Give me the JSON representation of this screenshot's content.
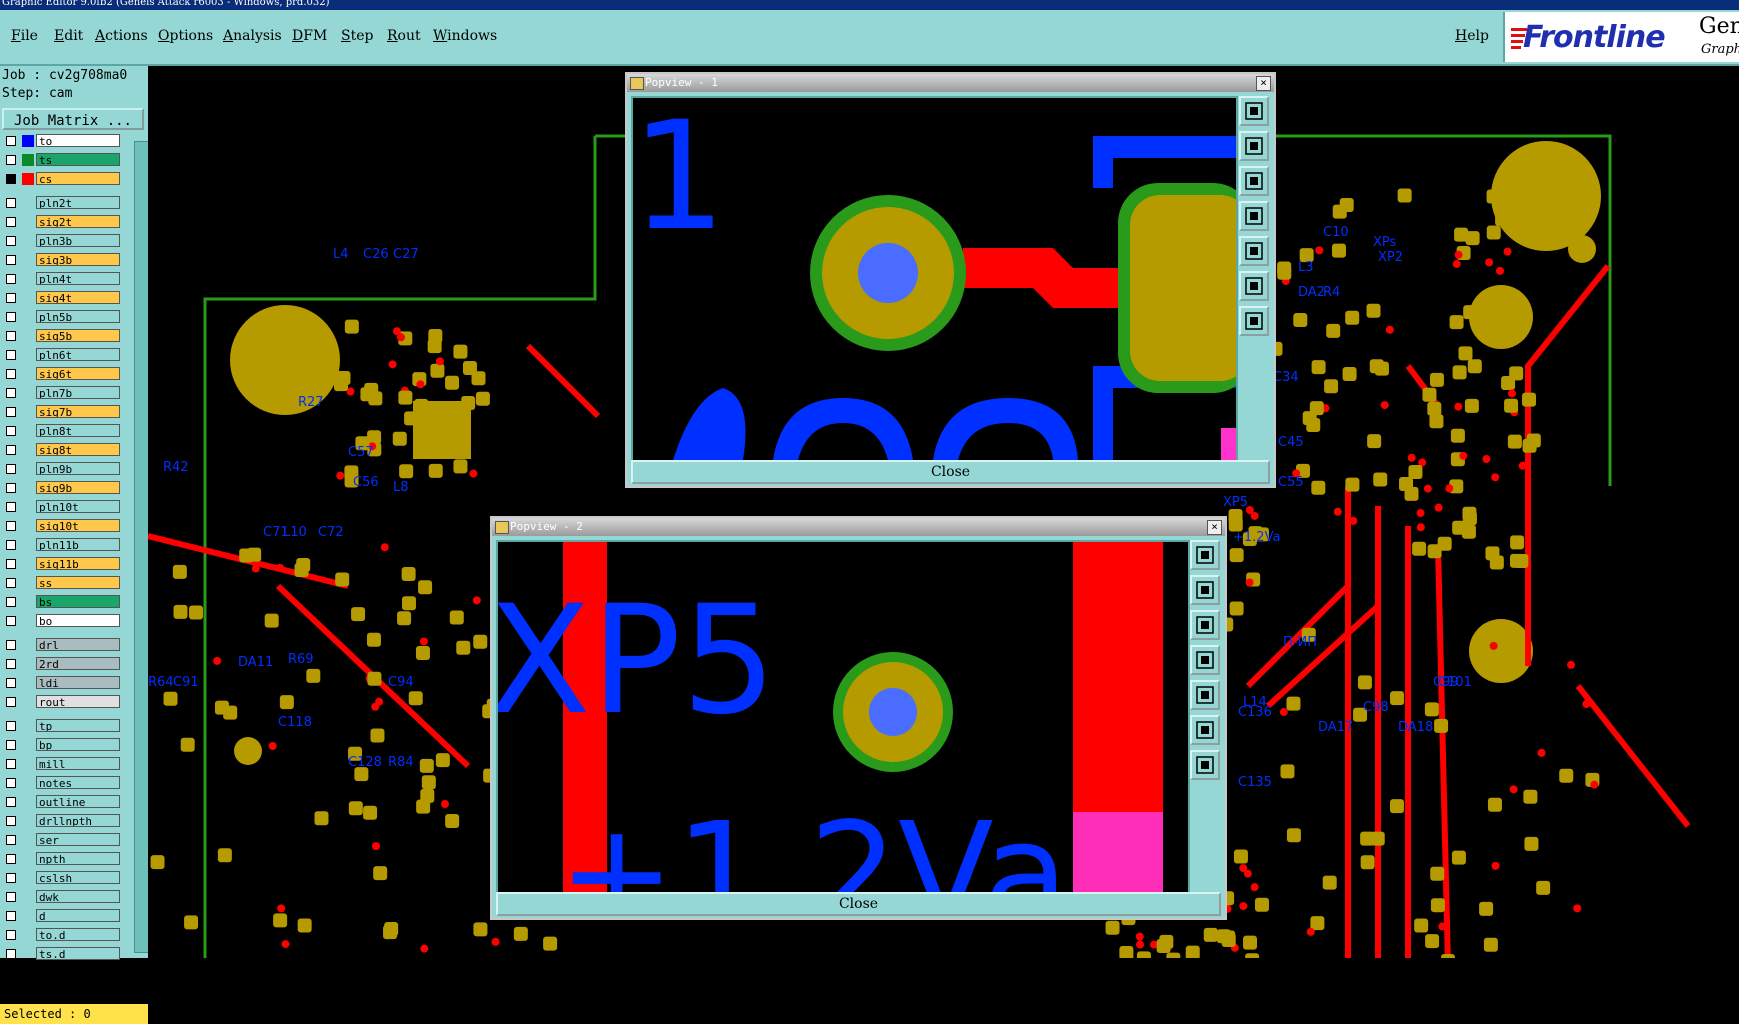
{
  "window": {
    "title": "Graphic Editor 9.0fb2 (Geneis Attack r6003 - Windows, prd.032)"
  },
  "menu": {
    "file": "File",
    "edit": "Edit",
    "actions": "Actions",
    "options": "Options",
    "analysis": "Analysis",
    "dfm": "DFM",
    "step": "Step",
    "rout": "Rout",
    "windows": "Windows",
    "help": "Help"
  },
  "logo": {
    "brand": "Frontline",
    "product": "Genesi",
    "subtitle": "Graphi"
  },
  "job": {
    "job_line": "Job : cv2g708ma0",
    "step_line": "Step: cam",
    "matrix_button": "Job Matrix ..."
  },
  "layers": [
    {
      "name": "to",
      "color": "#0000ff",
      "bg": "#ffffff",
      "checked": false
    },
    {
      "name": "ts",
      "color": "#0a8a2a",
      "bg": "#1aa56a",
      "checked": false
    },
    {
      "name": "cs",
      "color": "#ff0000",
      "bg": "#ffc84a",
      "checked": true
    },
    {
      "name": "pln2t",
      "color": "",
      "bg": "#94d7d4",
      "checked": false
    },
    {
      "name": "sig2t",
      "color": "",
      "bg": "#ffc84a",
      "checked": false
    },
    {
      "name": "pln3b",
      "color": "",
      "bg": "#94d7d4",
      "checked": false
    },
    {
      "name": "sig3b",
      "color": "",
      "bg": "#ffc84a",
      "checked": false
    },
    {
      "name": "pln4t",
      "color": "",
      "bg": "#94d7d4",
      "checked": false
    },
    {
      "name": "sig4t",
      "color": "",
      "bg": "#ffc84a",
      "checked": false
    },
    {
      "name": "pln5b",
      "color": "",
      "bg": "#94d7d4",
      "checked": false
    },
    {
      "name": "sig5b",
      "color": "",
      "bg": "#ffc84a",
      "checked": false
    },
    {
      "name": "pln6t",
      "color": "",
      "bg": "#94d7d4",
      "checked": false
    },
    {
      "name": "sig6t",
      "color": "",
      "bg": "#ffc84a",
      "checked": false
    },
    {
      "name": "pln7b",
      "color": "",
      "bg": "#94d7d4",
      "checked": false
    },
    {
      "name": "sig7b",
      "color": "",
      "bg": "#ffc84a",
      "checked": false
    },
    {
      "name": "pln8t",
      "color": "",
      "bg": "#94d7d4",
      "checked": false
    },
    {
      "name": "sig8t",
      "color": "",
      "bg": "#ffc84a",
      "checked": false
    },
    {
      "name": "pln9b",
      "color": "",
      "bg": "#94d7d4",
      "checked": false
    },
    {
      "name": "sig9b",
      "color": "",
      "bg": "#ffc84a",
      "checked": false
    },
    {
      "name": "pln10t",
      "color": "",
      "bg": "#94d7d4",
      "checked": false
    },
    {
      "name": "sig10t",
      "color": "",
      "bg": "#ffc84a",
      "checked": false
    },
    {
      "name": "pln11b",
      "color": "",
      "bg": "#94d7d4",
      "checked": false
    },
    {
      "name": "sig11b",
      "color": "",
      "bg": "#ffc84a",
      "checked": false
    },
    {
      "name": "ss",
      "color": "",
      "bg": "#ffc84a",
      "checked": false
    },
    {
      "name": "bs",
      "color": "",
      "bg": "#1aa56a",
      "checked": false
    },
    {
      "name": "bo",
      "color": "",
      "bg": "#ffffff",
      "checked": false
    },
    {
      "name": "drl",
      "color": "",
      "bg": "#a9bcc0",
      "checked": false
    },
    {
      "name": "2rd",
      "color": "",
      "bg": "#a9bcc0",
      "checked": false
    },
    {
      "name": "ldi",
      "color": "",
      "bg": "#a9bcc0",
      "checked": false
    },
    {
      "name": "rout",
      "color": "",
      "bg": "#e0e0e0",
      "checked": false
    },
    {
      "name": "tp",
      "color": "",
      "bg": "#94d7d4",
      "checked": false
    },
    {
      "name": "bp",
      "color": "",
      "bg": "#94d7d4",
      "checked": false
    },
    {
      "name": "mill",
      "color": "",
      "bg": "#94d7d4",
      "checked": false
    },
    {
      "name": "notes",
      "color": "",
      "bg": "#94d7d4",
      "checked": false
    },
    {
      "name": "outline",
      "color": "",
      "bg": "#94d7d4",
      "checked": false
    },
    {
      "name": "drllnpth",
      "color": "",
      "bg": "#94d7d4",
      "checked": false
    },
    {
      "name": "ser",
      "color": "",
      "bg": "#94d7d4",
      "checked": false
    },
    {
      "name": "npth",
      "color": "",
      "bg": "#94d7d4",
      "checked": false
    },
    {
      "name": "cslsh",
      "color": "",
      "bg": "#94d7d4",
      "checked": false
    },
    {
      "name": "dwk",
      "color": "",
      "bg": "#94d7d4",
      "checked": false
    },
    {
      "name": "d",
      "color": "",
      "bg": "#94d7d4",
      "checked": false
    },
    {
      "name": "to.d",
      "color": "",
      "bg": "#94d7d4",
      "checked": false
    },
    {
      "name": "ts.d",
      "color": "",
      "bg": "#94d7d4",
      "checked": false
    }
  ],
  "status": {
    "selected": "Selected : 0"
  },
  "popview1": {
    "title": "Popview - 1",
    "close_label": "Close",
    "silk_text": "1"
  },
  "popview2": {
    "title": "Popview - 2",
    "close_label": "Close",
    "silk_text_1": "XP5",
    "silk_text_2": "+1.2Va"
  },
  "board_labels": [
    "L4",
    "C26",
    "C27",
    "R27",
    "C57",
    "C56",
    "L8",
    "R42",
    "C71",
    "L10",
    "C72",
    "DA11",
    "R69",
    "C118",
    "C128",
    "R84",
    "R64",
    "C91",
    "C94",
    "XP",
    "R2",
    "DA2",
    "C15",
    "C10",
    "R4",
    "R12",
    "C23",
    "L3",
    "C34",
    "XPs",
    "XP2",
    "C45",
    "C55",
    "R29",
    "C69",
    "DA7",
    "R41",
    "XP5",
    "+1.2Va",
    "П-ИП",
    "L14",
    "C98",
    "C99",
    "C101",
    "DA17",
    "DA18",
    "DA16",
    "C136",
    "C135",
    "C51"
  ],
  "colors": {
    "menubar": "#94d7d4",
    "pad": "#b59a00",
    "trace": "#ff0000",
    "silk": "#0030ff",
    "outline": "#2a9a1a"
  }
}
